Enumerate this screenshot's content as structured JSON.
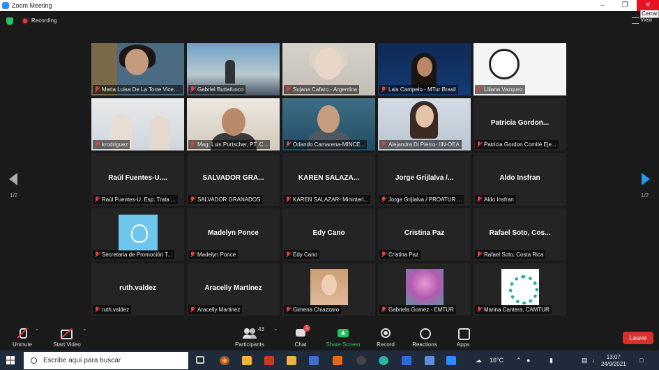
{
  "window": {
    "title": "Zoom Meeting",
    "tooltip": "Cerrar"
  },
  "topbar": {
    "recording": "Recording",
    "view": "View"
  },
  "pager": {
    "left": "1/2",
    "right": "1/2"
  },
  "tiles": [
    {
      "big": "",
      "name": "Maria Luisa De La Torre Vicente",
      "photo": "ph-woman1",
      "active": true
    },
    {
      "big": "",
      "name": "Gabriel Buttafuoco",
      "photo": "ph-port"
    },
    {
      "big": "",
      "name": "Sujana Cafaro - Argentina",
      "photo": "ph-woman2"
    },
    {
      "big": "",
      "name": "Lais Campelo - MTur Brasil",
      "photo": "ph-tur"
    },
    {
      "big": "",
      "name": "Liliana Vazquez",
      "photo": "ph-afeet"
    },
    {
      "big": "",
      "name": "krodriguez",
      "photo": "ph-room"
    },
    {
      "big": "",
      "name": "Mag. Luis Purtscher, PT. C...",
      "photo": "ph-man1"
    },
    {
      "big": "",
      "name": "Orlando Camarena-MINCE...",
      "photo": "ph-man2"
    },
    {
      "big": "",
      "name": "Alejandra Di Pierro- IIN-OEA",
      "photo": "ph-woman3"
    },
    {
      "big": "Patricia  Gordon...",
      "name": "Patricia Gordon Comité Eje...",
      "photo": ""
    },
    {
      "big": "Raúl  Fuentes-U....",
      "name": "Raúl Fuentes-U. Esp. Trata ...",
      "photo": ""
    },
    {
      "big": "SALVADOR  GRA...",
      "name": "SALVADOR GRANADOS",
      "photo": ""
    },
    {
      "big": "KAREN  SALAZA...",
      "name": "KAREN SALAZAR- Mininteri...",
      "photo": ""
    },
    {
      "big": "Jorge  Grijlalva  /...",
      "name": "Jorge Grijlalva / PROATUR ...",
      "photo": ""
    },
    {
      "big": "Aldo Insfran",
      "name": "Aldo Insfran",
      "photo": ""
    },
    {
      "big": "",
      "name": "Secretaria de Promoción T...",
      "photo": "ph-flag"
    },
    {
      "big": "Madelyn Ponce",
      "name": "Madelyn Ponce",
      "photo": ""
    },
    {
      "big": "Edy Cano",
      "name": "Edy Cano",
      "photo": ""
    },
    {
      "big": "Cristina Paz",
      "name": "Cristina Paz",
      "photo": ""
    },
    {
      "big": "Rafael  Soto,  Cos...",
      "name": "Rafael Soto, Costa Rica",
      "photo": ""
    },
    {
      "big": "ruth.valdez",
      "name": "ruth.valdez",
      "photo": ""
    },
    {
      "big": "Aracelly Martinez",
      "name": "Aracelly Martinez",
      "photo": ""
    },
    {
      "big": "",
      "name": "Gimena Chiazzaro",
      "photo": "ph-gimena"
    },
    {
      "big": "",
      "name": "Gabriela Gomez - EMTUR",
      "photo": "ph-tree"
    },
    {
      "big": "",
      "name": "Marina Cantera, CAMTUR",
      "photo": "ph-camtur"
    }
  ],
  "toolbar": {
    "unmute": "Unmute",
    "start_video": "Start Video",
    "participants": "Participants",
    "participants_count": "43",
    "chat": "Chat",
    "chat_badge": "1",
    "share": "Share Screen",
    "record": "Record",
    "reactions": "Reactions",
    "apps": "Apps",
    "leave": "Leave",
    "share_color": "#23c55e",
    "leave_color": "#d8302c"
  },
  "taskbar": {
    "search_placeholder": "Escribe aquí para buscar",
    "temperature": "16°C",
    "time": "13:07",
    "date": "24/9/2021"
  }
}
